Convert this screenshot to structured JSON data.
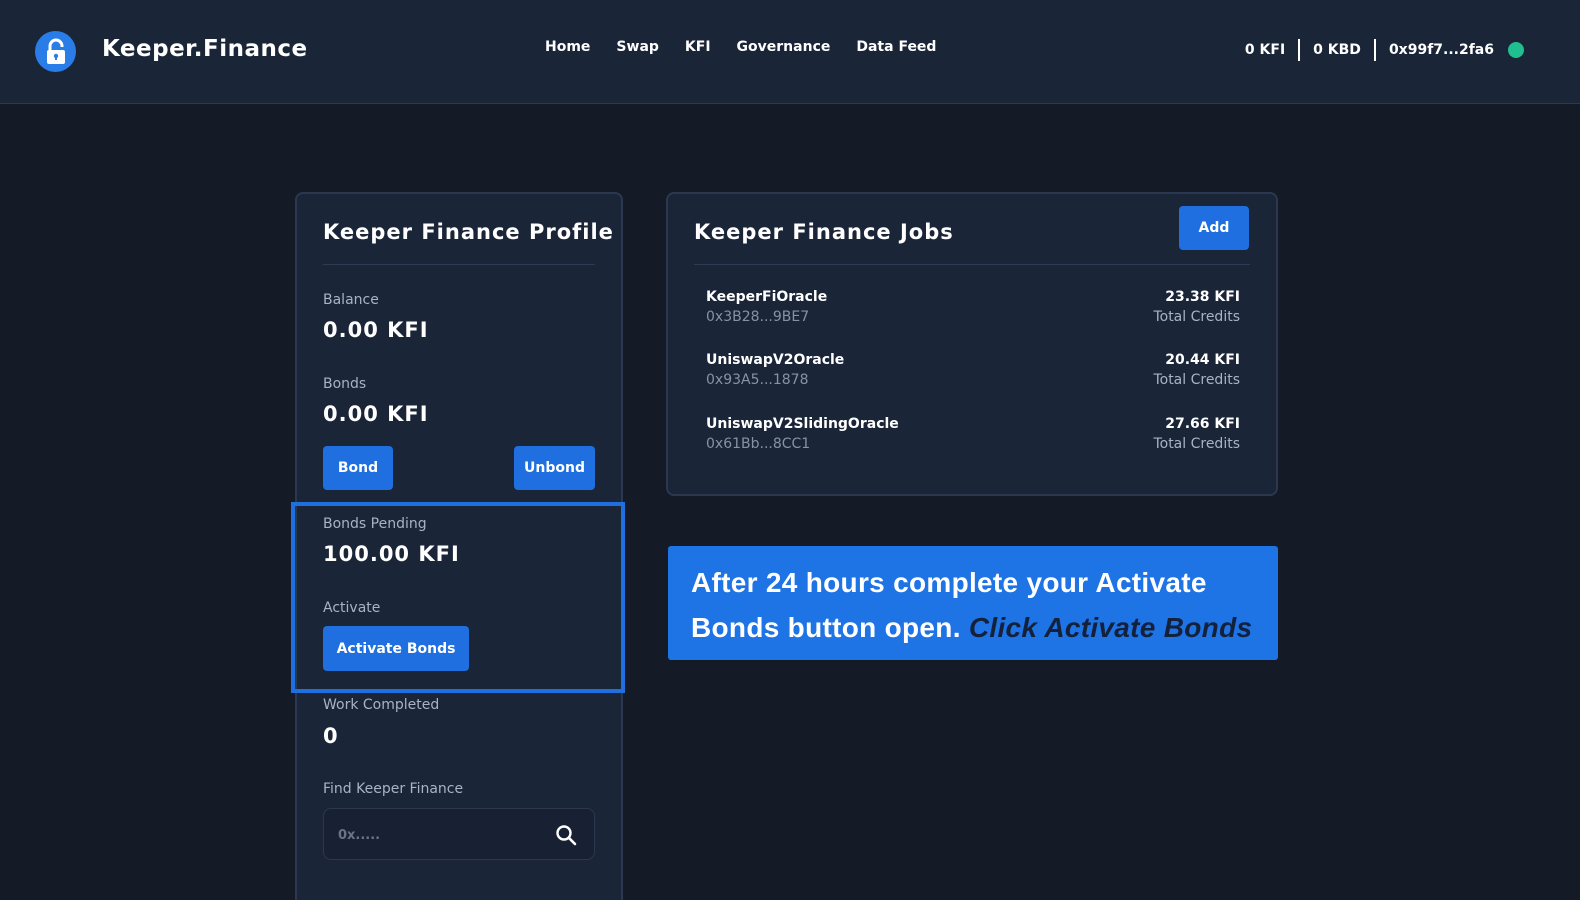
{
  "header": {
    "brand": "Keeper.Finance",
    "nav": [
      "Home",
      "Swap",
      "KFI",
      "Governance",
      "Data Feed"
    ],
    "kfi_balance": "0 KFI",
    "kbd_balance": "0 KBD",
    "wallet": "0x99f7...2fa6"
  },
  "profile": {
    "title": "Keeper Finance Profile",
    "balance_label": "Balance",
    "balance_value": "0.00 KFI",
    "bonds_label": "Bonds",
    "bonds_value": "0.00 KFI",
    "bond_button": "Bond",
    "unbond_button": "Unbond",
    "bonds_pending_label": "Bonds Pending",
    "bonds_pending_value": "100.00 KFI",
    "activate_label": "Activate",
    "activate_button": "Activate Bonds",
    "work_completed_label": "Work Completed",
    "work_completed_value": "0",
    "find_label": "Find Keeper Finance",
    "search_placeholder": "0x....."
  },
  "jobs": {
    "title": "Keeper Finance Jobs",
    "add_button": "Add",
    "items": [
      {
        "name": "KeeperFiOracle",
        "address": "0x3B28...9BE7",
        "amount": "23.38 KFI",
        "credits_label": "Total Credits"
      },
      {
        "name": "UniswapV2Oracle",
        "address": "0x93A5...1878",
        "amount": "20.44 KFI",
        "credits_label": "Total Credits"
      },
      {
        "name": "UniswapV2SlidingOracle",
        "address": "0x61Bb...8CC1",
        "amount": "27.66 KFI",
        "credits_label": "Total Credits"
      }
    ]
  },
  "banner": {
    "text_line1": "After 24 hours complete your Activate",
    "text_line2": "Bonds button open. ",
    "emphasis": "Click Activate Bonds"
  },
  "colors": {
    "background": "#141a26",
    "card": "#1b2538",
    "accent": "#1f6fe0",
    "status_online": "#1fbf8f"
  }
}
